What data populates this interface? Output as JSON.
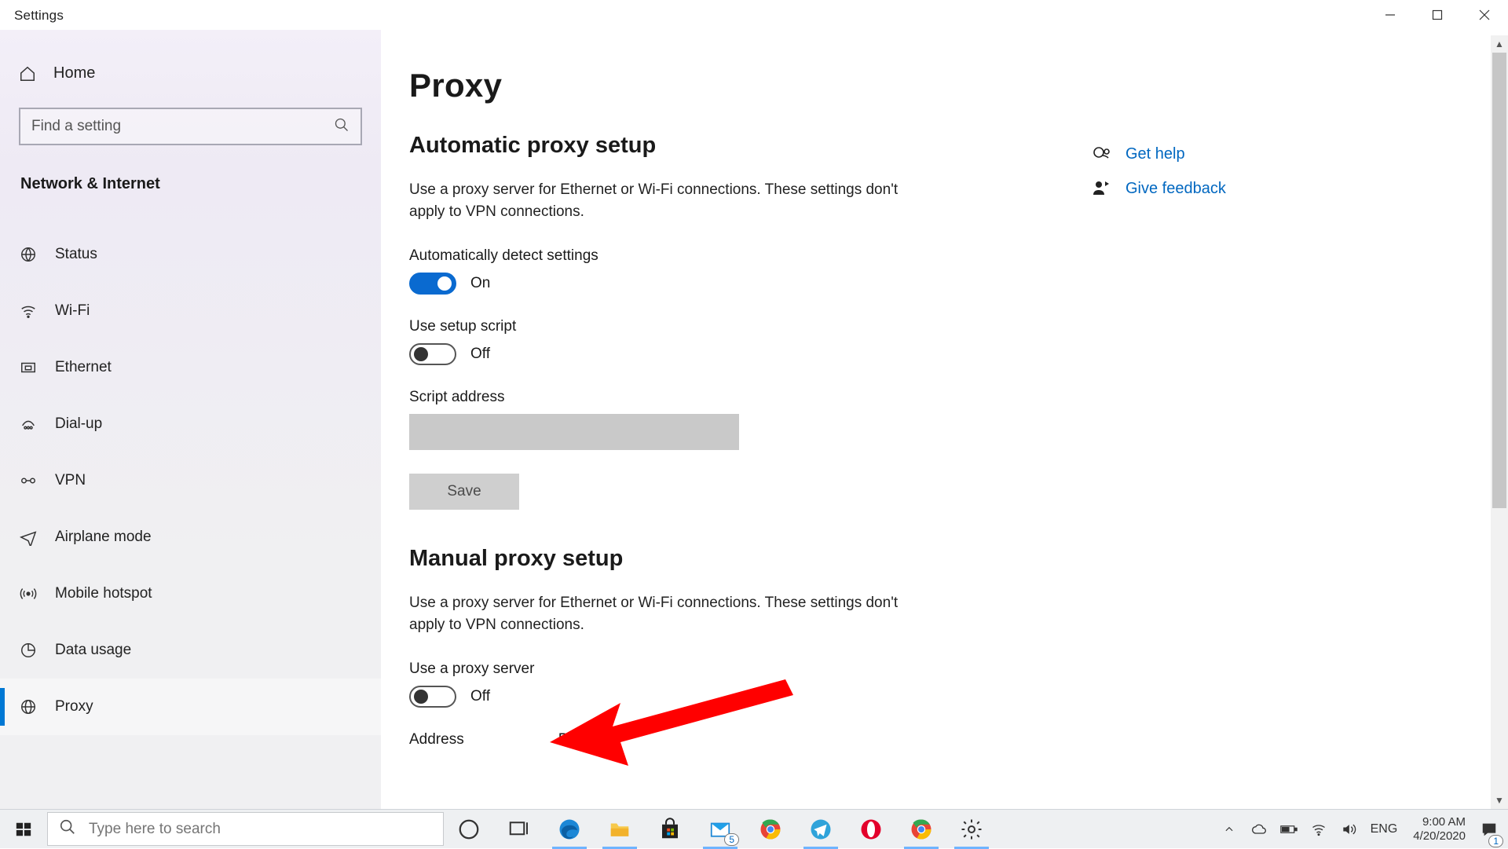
{
  "window": {
    "title": "Settings"
  },
  "sidebar": {
    "home_label": "Home",
    "search_placeholder": "Find a setting",
    "section_label": "Network & Internet",
    "items": [
      {
        "label": "Status"
      },
      {
        "label": "Wi-Fi"
      },
      {
        "label": "Ethernet"
      },
      {
        "label": "Dial-up"
      },
      {
        "label": "VPN"
      },
      {
        "label": "Airplane mode"
      },
      {
        "label": "Mobile hotspot"
      },
      {
        "label": "Data usage"
      },
      {
        "label": "Proxy"
      }
    ]
  },
  "page": {
    "title": "Proxy",
    "auto_section_heading": "Automatic proxy setup",
    "auto_desc": "Use a proxy server for Ethernet or Wi-Fi connections. These settings don't apply to VPN connections.",
    "auto_detect_label": "Automatically detect settings",
    "auto_detect_toggle": "On",
    "use_script_label": "Use setup script",
    "use_script_toggle": "Off",
    "script_address_label": "Script address",
    "script_address_value": "",
    "save_button": "Save",
    "manual_section_heading": "Manual proxy setup",
    "manual_desc": "Use a proxy server for Ethernet or Wi-Fi connections. These settings don't apply to VPN connections.",
    "use_proxy_label": "Use a proxy server",
    "use_proxy_toggle": "Off",
    "address_label": "Address",
    "port_label": "Port"
  },
  "side_links": {
    "get_help": "Get help",
    "give_feedback": "Give feedback"
  },
  "taskbar": {
    "search_placeholder": "Type here to search",
    "lang": "ENG",
    "time": "9:00 AM",
    "date": "4/20/2020",
    "mail_badge": "5",
    "notifications_badge": "1"
  }
}
